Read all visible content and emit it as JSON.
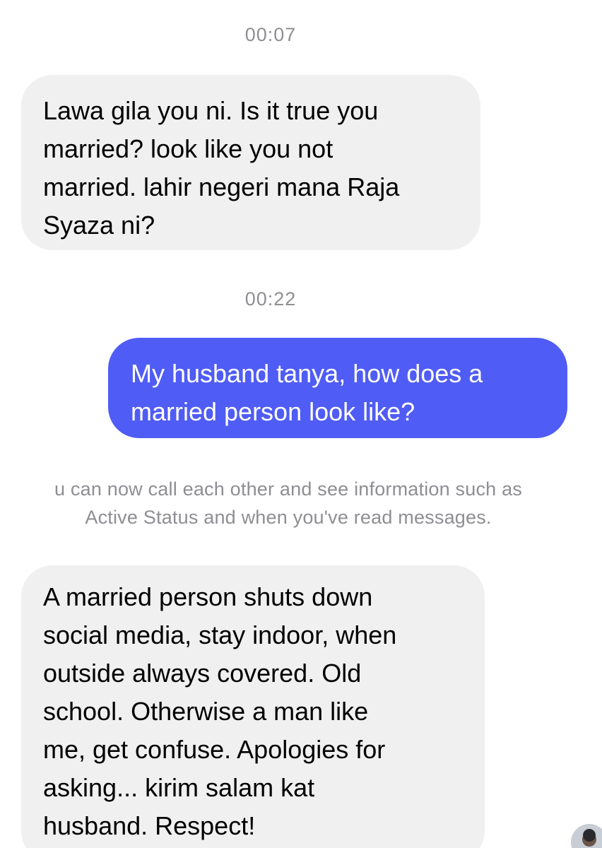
{
  "messages": [
    {
      "timestamp": "00:07",
      "direction": "incoming",
      "text": "Lawa gila you ni. Is it true you\nmarried? look like you not\nmarried. lahir negeri mana Raja\nSyaza ni?"
    },
    {
      "timestamp": "00:22",
      "direction": "outgoing",
      "text": "My husband tanya, how does a\nmarried person look like?"
    },
    {
      "direction": "incoming",
      "text": "A married person shuts down\nsocial media, stay indoor, when\noutside always covered. Old\nschool. Otherwise a man like\nme, get confuse. Apologies for\nasking... kirim salam kat\nhusband. Respect!"
    }
  ],
  "system_notice": "u can now call each other and see information such as\nActive Status and when you've read messages.",
  "colors": {
    "incoming_bubble": "#f0f0f0",
    "outgoing_bubble": "#4f5cf5",
    "timestamp_text": "#8e8e93"
  },
  "icons": {
    "sender_avatar": "avatar"
  }
}
